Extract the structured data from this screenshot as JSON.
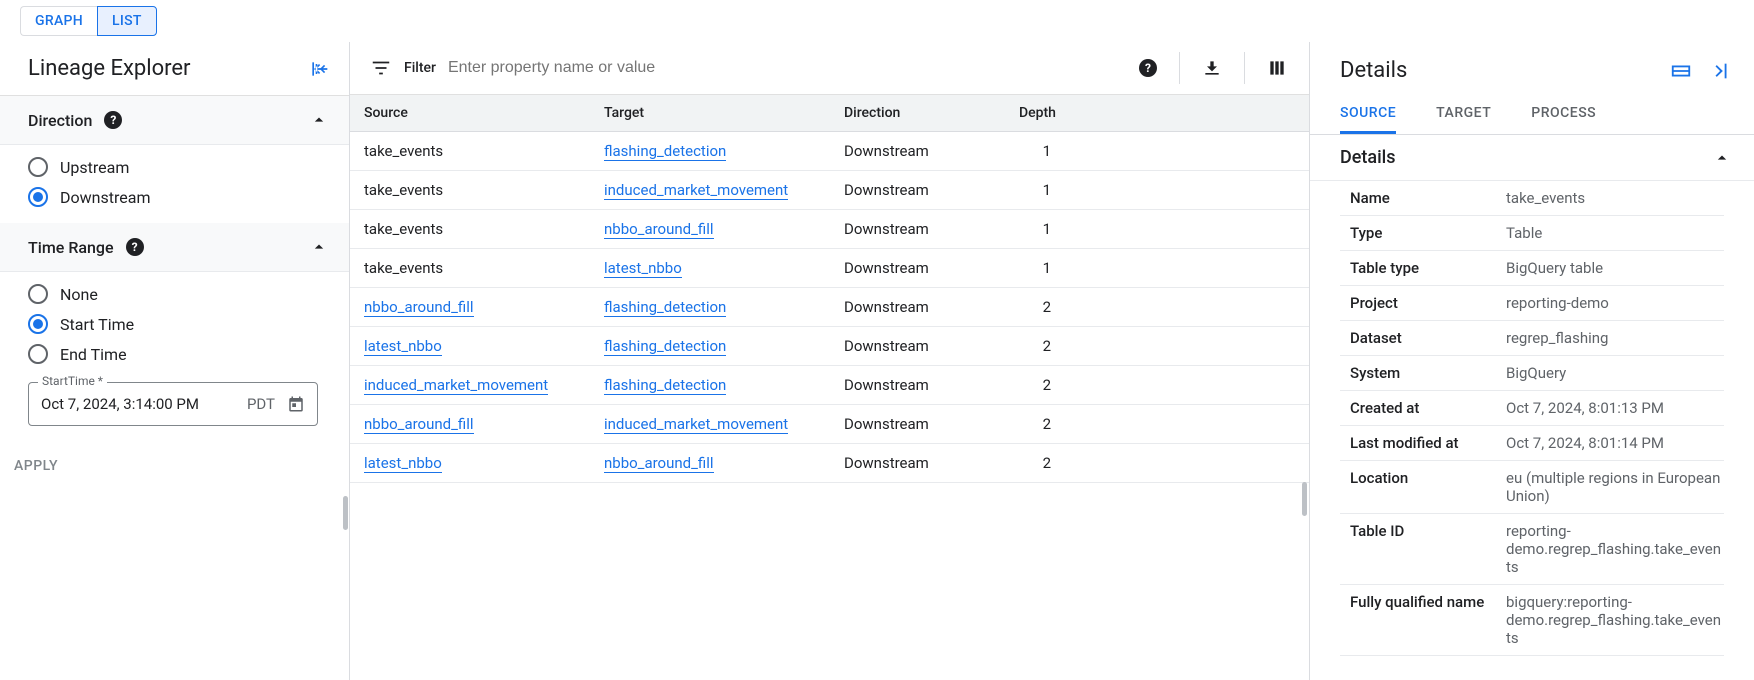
{
  "topTabs": {
    "graph": "GRAPH",
    "list": "LIST"
  },
  "sidebar": {
    "title": "Lineage Explorer",
    "direction": {
      "heading": "Direction",
      "options": {
        "upstream": "Upstream",
        "downstream": "Downstream"
      },
      "selected": "downstream"
    },
    "timeRange": {
      "heading": "Time Range",
      "options": {
        "none": "None",
        "start": "Start Time",
        "end": "End Time"
      },
      "selected": "start",
      "fieldLabel": "StartTime *",
      "value": "Oct 7, 2024, 3:14:00 PM",
      "tz": "PDT"
    },
    "apply": "APPLY"
  },
  "filter": {
    "label": "Filter",
    "placeholder": "Enter property name or value"
  },
  "columns": {
    "source": "Source",
    "target": "Target",
    "direction": "Direction",
    "depth": "Depth"
  },
  "rows": [
    {
      "source": "take_events",
      "sourceLink": false,
      "target": "flashing_detection",
      "direction": "Downstream",
      "depth": "1"
    },
    {
      "source": "take_events",
      "sourceLink": false,
      "target": "induced_market_movement",
      "direction": "Downstream",
      "depth": "1"
    },
    {
      "source": "take_events",
      "sourceLink": false,
      "target": "nbbo_around_fill",
      "direction": "Downstream",
      "depth": "1"
    },
    {
      "source": "take_events",
      "sourceLink": false,
      "target": "latest_nbbo",
      "direction": "Downstream",
      "depth": "1"
    },
    {
      "source": "nbbo_around_fill",
      "sourceLink": true,
      "target": "flashing_detection",
      "direction": "Downstream",
      "depth": "2"
    },
    {
      "source": "latest_nbbo",
      "sourceLink": true,
      "target": "flashing_detection",
      "direction": "Downstream",
      "depth": "2"
    },
    {
      "source": "induced_market_movement",
      "sourceLink": true,
      "target": "flashing_detection",
      "direction": "Downstream",
      "depth": "2"
    },
    {
      "source": "nbbo_around_fill",
      "sourceLink": true,
      "target": "induced_market_movement",
      "direction": "Downstream",
      "depth": "2"
    },
    {
      "source": "latest_nbbo",
      "sourceLink": true,
      "target": "nbbo_around_fill",
      "direction": "Downstream",
      "depth": "2"
    }
  ],
  "details": {
    "title": "Details",
    "tabs": {
      "source": "SOURCE",
      "target": "TARGET",
      "process": "PROCESS"
    },
    "sectionTitle": "Details",
    "kv": [
      {
        "k": "Name",
        "v": "take_events"
      },
      {
        "k": "Type",
        "v": "Table"
      },
      {
        "k": "Table type",
        "v": "BigQuery table"
      },
      {
        "k": "Project",
        "v": "reporting-demo"
      },
      {
        "k": "Dataset",
        "v": "regrep_flashing"
      },
      {
        "k": "System",
        "v": "BigQuery"
      },
      {
        "k": "Created at",
        "v": "Oct 7, 2024, 8:01:13 PM"
      },
      {
        "k": "Last modified at",
        "v": "Oct 7, 2024, 8:01:14 PM"
      },
      {
        "k": "Location",
        "v": "eu (multiple regions in European Union)"
      },
      {
        "k": "Table ID",
        "v": "reporting-demo.regrep_flashing.take_events"
      },
      {
        "k": "Fully qualified name",
        "v": "bigquery:reporting-demo.regrep_flashing.take_events"
      }
    ]
  }
}
